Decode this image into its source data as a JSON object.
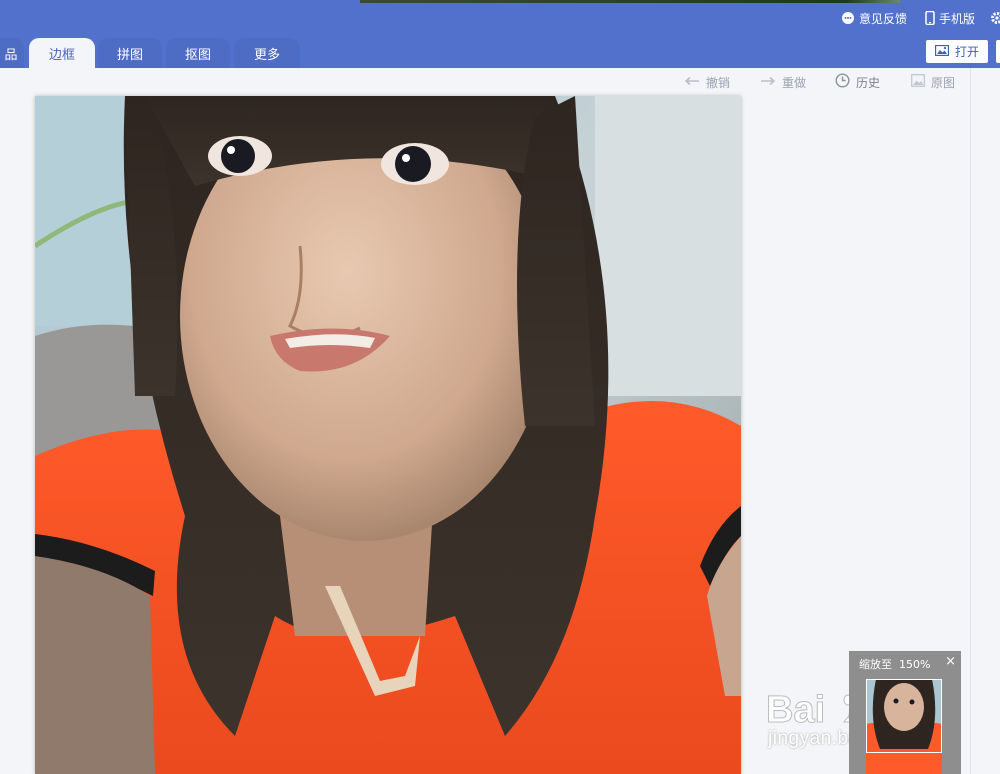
{
  "header": {
    "feedback_label": "意见反馈",
    "mobile_label": "手机版",
    "open_label": "打开"
  },
  "tabs": [
    {
      "label": "品"
    },
    {
      "label": "边框"
    },
    {
      "label": "拼图"
    },
    {
      "label": "抠图"
    },
    {
      "label": "更多"
    }
  ],
  "toolbar": {
    "undo_label": "撤销",
    "redo_label": "重做",
    "history_label": "历史",
    "original_label": "原图"
  },
  "zoom": {
    "label": "缩放至",
    "value": "150%",
    "close": "×"
  },
  "watermark": {
    "logo_text": "Baidu经验",
    "url": "jingyan.baidu.com"
  },
  "colors": {
    "header": "#5271cc",
    "active_tab_text": "#4766c2",
    "canvas_bg": "#f4f5f8"
  }
}
